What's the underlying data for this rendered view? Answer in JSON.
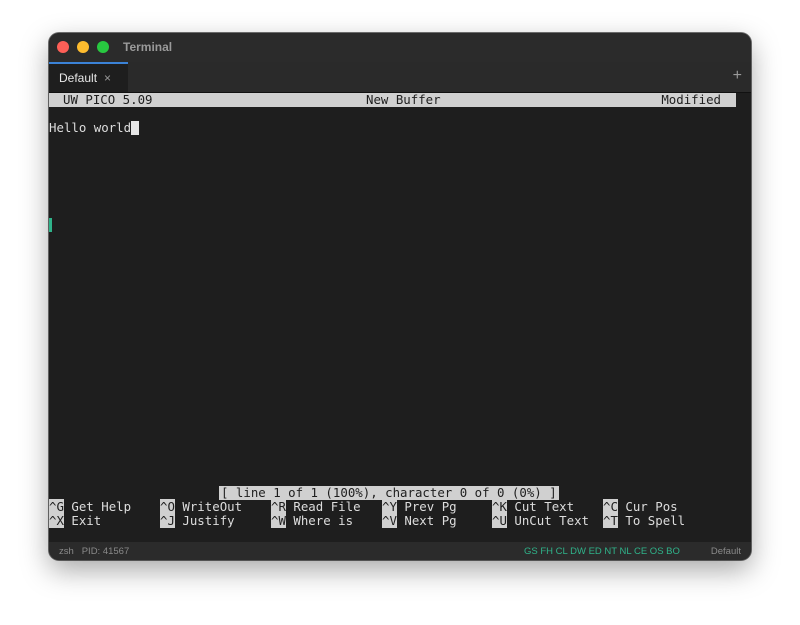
{
  "window": {
    "title": "Terminal"
  },
  "tabs": [
    {
      "label": "Default",
      "close": "×"
    }
  ],
  "tab_add": "+",
  "editor": {
    "header": {
      "left": "UW PICO 5.09",
      "center": "New Buffer",
      "right": "Modified"
    },
    "content_line": "Hello world",
    "status": "[ line 1 of 1 (100%), character 0 of 0 (0%) ]",
    "shortcuts_row1": [
      {
        "key": "^G",
        "label": "Get Help"
      },
      {
        "key": "^O",
        "label": "WriteOut"
      },
      {
        "key": "^R",
        "label": "Read File"
      },
      {
        "key": "^Y",
        "label": "Prev Pg"
      },
      {
        "key": "^K",
        "label": "Cut Text"
      },
      {
        "key": "^C",
        "label": "Cur Pos"
      }
    ],
    "shortcuts_row2": [
      {
        "key": "^X",
        "label": "Exit"
      },
      {
        "key": "^J",
        "label": "Justify"
      },
      {
        "key": "^W",
        "label": "Where is"
      },
      {
        "key": "^V",
        "label": "Next Pg"
      },
      {
        "key": "^U",
        "label": "UnCut Text"
      },
      {
        "key": "^T",
        "label": "To Spell"
      }
    ]
  },
  "footer": {
    "shell": "zsh",
    "pid": "PID: 41567",
    "flags": "GS FH CL DW ED NT NL CE OS BO",
    "profile": "Default"
  },
  "colors": {
    "terminal_bg": "#1e1e1e",
    "inverse_bg": "#d0d0d0",
    "flag_green": "#2fb38a",
    "tab_accent": "#3b82d6"
  }
}
